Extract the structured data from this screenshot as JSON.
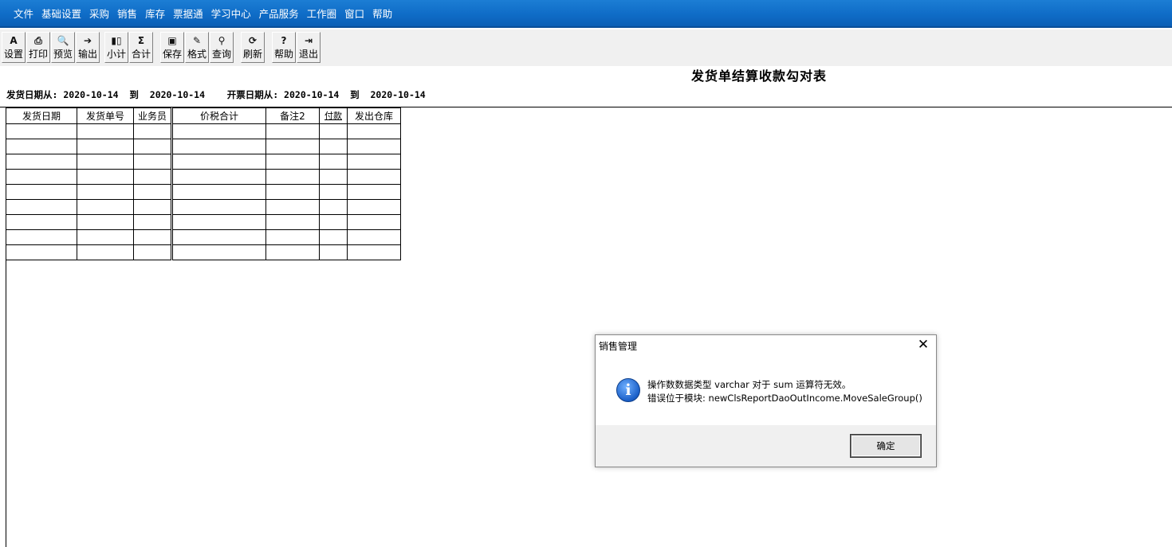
{
  "menu": [
    "文件",
    "基础设置",
    "采购",
    "销售",
    "库存",
    "票据通",
    "学习中心",
    "产品服务",
    "工作圈",
    "窗口",
    "帮助"
  ],
  "toolbar": {
    "groups": [
      [
        {
          "label": "设置",
          "icon": "page-setup-icon",
          "glyph": "A"
        },
        {
          "label": "打印",
          "icon": "printer-icon",
          "glyph": "⎙"
        },
        {
          "label": "预览",
          "icon": "print-preview-icon",
          "glyph": "🔍"
        },
        {
          "label": "输出",
          "icon": "export-icon",
          "glyph": "➔"
        }
      ],
      [
        {
          "label": "小计",
          "icon": "subtotal-icon",
          "glyph": "▮▯"
        },
        {
          "label": "合计",
          "icon": "total-icon",
          "glyph": "Σ"
        }
      ],
      [
        {
          "label": "保存",
          "icon": "save-icon",
          "glyph": "▣"
        },
        {
          "label": "格式",
          "icon": "format-icon",
          "glyph": "✎"
        },
        {
          "label": "查询",
          "icon": "binoculars-icon",
          "glyph": "⚲"
        }
      ],
      [
        {
          "label": "刷新",
          "icon": "refresh-icon",
          "glyph": "⟳"
        }
      ],
      [
        {
          "label": "帮助",
          "icon": "help-icon",
          "glyph": "?"
        },
        {
          "label": "退出",
          "icon": "exit-icon",
          "glyph": "⇥"
        }
      ]
    ]
  },
  "report": {
    "title": "发货单结算收款勾对表",
    "criteria": "发货日期从: 2020-10-14  到  2020-10-14    开票日期从: 2020-10-14  到  2020-10-14",
    "columns": [
      "发货日期",
      "发货单号",
      "业务员",
      "价税合计",
      "备注2",
      "付款",
      "发出仓库"
    ],
    "empty_rows": 9
  },
  "dialog": {
    "title": "销售管理",
    "message_line1": "操作数数据类型 varchar 对于 sum 运算符无效。",
    "message_line2": "错误位于模块: newClsReportDaoOutIncome.MoveSaleGroup()",
    "ok_label": "确定",
    "close_glyph": "✕",
    "icon": "info-icon"
  }
}
